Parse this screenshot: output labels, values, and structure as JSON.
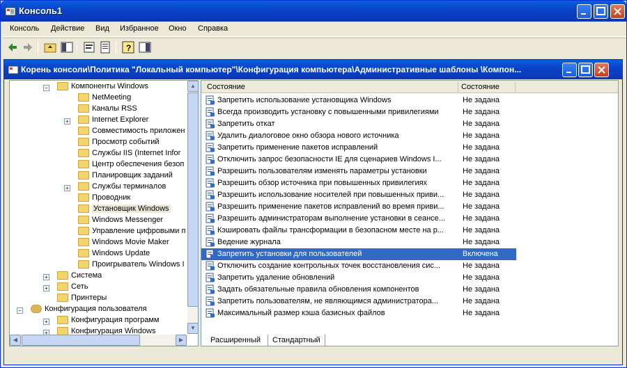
{
  "window": {
    "title": "Консоль1"
  },
  "menu": [
    "Консоль",
    "Действие",
    "Вид",
    "Избранное",
    "Окно",
    "Справка"
  ],
  "child": {
    "title": "Корень консоли\\Политика \"Локальный компьютер\"\\Конфигурация компьютера\\Административные шаблоны \\Компон..."
  },
  "tree": {
    "items": [
      {
        "label": "Компоненты Windows",
        "level": 2,
        "expander": "minus"
      },
      {
        "label": "NetMeeting",
        "level": 3,
        "expander": ""
      },
      {
        "label": "Каналы RSS",
        "level": 3,
        "expander": ""
      },
      {
        "label": "Internet Explorer",
        "level": 3,
        "expander": "plus"
      },
      {
        "label": "Совместимость приложен",
        "level": 3,
        "expander": ""
      },
      {
        "label": "Просмотр событий",
        "level": 3,
        "expander": ""
      },
      {
        "label": "Службы IIS (Internet Infor",
        "level": 3,
        "expander": ""
      },
      {
        "label": "Центр обеспечения безоп",
        "level": 3,
        "expander": ""
      },
      {
        "label": "Планировщик заданий",
        "level": 3,
        "expander": ""
      },
      {
        "label": "Службы терминалов",
        "level": 3,
        "expander": "plus"
      },
      {
        "label": "Проводник",
        "level": 3,
        "expander": ""
      },
      {
        "label": "Установщик Windows",
        "level": 3,
        "expander": "",
        "selected": true
      },
      {
        "label": "Windows Messenger",
        "level": 3,
        "expander": ""
      },
      {
        "label": "Управление цифровыми п",
        "level": 3,
        "expander": ""
      },
      {
        "label": "Windows Movie Maker",
        "level": 3,
        "expander": ""
      },
      {
        "label": "Windows Update",
        "level": 3,
        "expander": ""
      },
      {
        "label": "Проигрыватель Windows I",
        "level": 3,
        "expander": ""
      },
      {
        "label": "Система",
        "level": 2,
        "expander": "plus"
      },
      {
        "label": "Сеть",
        "level": 2,
        "expander": "plus"
      },
      {
        "label": "Принтеры",
        "level": 2,
        "expander": ""
      },
      {
        "label": "Конфигурация пользователя",
        "level": 1,
        "expander": "minus",
        "icon": "user"
      },
      {
        "label": "Конфигурация программ",
        "level": 2,
        "expander": "plus"
      },
      {
        "label": "Конфигурация Windows",
        "level": 2,
        "expander": "plus"
      }
    ]
  },
  "list": {
    "headers": [
      "Состояние",
      "Состояние"
    ],
    "rows": [
      {
        "name": "Запретить использование установщика Windows",
        "state": "Не задана"
      },
      {
        "name": "Всегда производить установку с повышенными привилегиями",
        "state": "Не задана"
      },
      {
        "name": "Запретить откат",
        "state": "Не задана"
      },
      {
        "name": "Удалить диалоговое окно обзора нового источника",
        "state": "Не задана"
      },
      {
        "name": "Запретить применение пакетов исправлений",
        "state": "Не задана"
      },
      {
        "name": "Отключить запрос безопасности IE для сценариев Windows I...",
        "state": "Не задана"
      },
      {
        "name": "Разрешить пользователям изменять параметры установки",
        "state": "Не задана"
      },
      {
        "name": "Разрешить обзор источника при повышенных привилегиях",
        "state": "Не задана"
      },
      {
        "name": "Разрешить использование носителей при повышенных приви...",
        "state": "Не задана"
      },
      {
        "name": "Разрешить применение пакетов исправлений во время приви...",
        "state": "Не задана"
      },
      {
        "name": "Разрешить администраторам выполнение установки в сеансе...",
        "state": "Не задана"
      },
      {
        "name": "Кэшировать файлы трансформации  в безопасном месте на р...",
        "state": "Не задана"
      },
      {
        "name": "Ведение журнала",
        "state": "Не задана"
      },
      {
        "name": "Запретить установки для пользователей",
        "state": "Включена",
        "selected": true
      },
      {
        "name": "Отключить создание контрольных точек восстановления сис...",
        "state": "Не задана"
      },
      {
        "name": "Запретить удаление обновлений",
        "state": "Не задана"
      },
      {
        "name": "Задать обязательные правила обновления компонентов",
        "state": "Не задана"
      },
      {
        "name": "Запретить пользователям, не являющимся администратора...",
        "state": "Не задана"
      },
      {
        "name": "Максимальный размер кэша базисных файлов",
        "state": "Не задана"
      }
    ]
  },
  "tabs": [
    "Расширенный",
    "Стандартный"
  ],
  "colors": {
    "titlebar": "#0a5ee0",
    "selection": "#316ac5",
    "folder": "#f3d56b"
  }
}
